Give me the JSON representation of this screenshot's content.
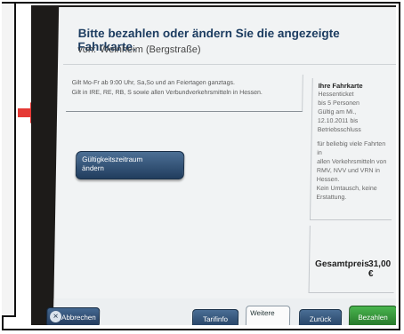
{
  "header": {
    "title": "Bitte bezahlen oder ändern Sie die angezeigte Fahrkarte.",
    "from_label": "von:",
    "from_station": "Weinheim (Bergstraße)"
  },
  "validity_text": [
    "Gilt Mo-Fr ab 9:00 Uhr, Sa,So und an Feiertagen ganztags.",
    "Gilt in IRE, RE, RB, S sowie allen Verbundverkehrsmitteln in Hessen."
  ],
  "period_button": [
    "Gültigkeitszeitraum",
    "ändern"
  ],
  "ticket": {
    "heading": "Ihre Fahrkarte",
    "lines_a": [
      "Hessenticket",
      "bis 5 Personen",
      "Gültig am Mi., 12.10.2011 bis",
      "Betriebsschluss"
    ],
    "lines_b": [
      "für beliebig viele Fahrten in",
      "allen Verkehrsmitteln von",
      "RMV, NVV und VRN in Hessen.",
      "Kein Umtausch, keine",
      "Erstattung."
    ]
  },
  "total": {
    "label": "Gesamtpreis",
    "amount": "31,00 €"
  },
  "buttons": {
    "cancel": "Abbrechen",
    "tarif": "Tarifinfo",
    "more": "Weitere",
    "back": "Zurück",
    "pay": "Bezahlen"
  },
  "colors": {
    "screen_bg": "#f1f3f4",
    "accent_blue": "#2a4a70",
    "pay_green": "#2f8f34",
    "arrow_red": "#e53935"
  },
  "icons": [
    "arrow-right-icon",
    "close-circle-icon"
  ]
}
